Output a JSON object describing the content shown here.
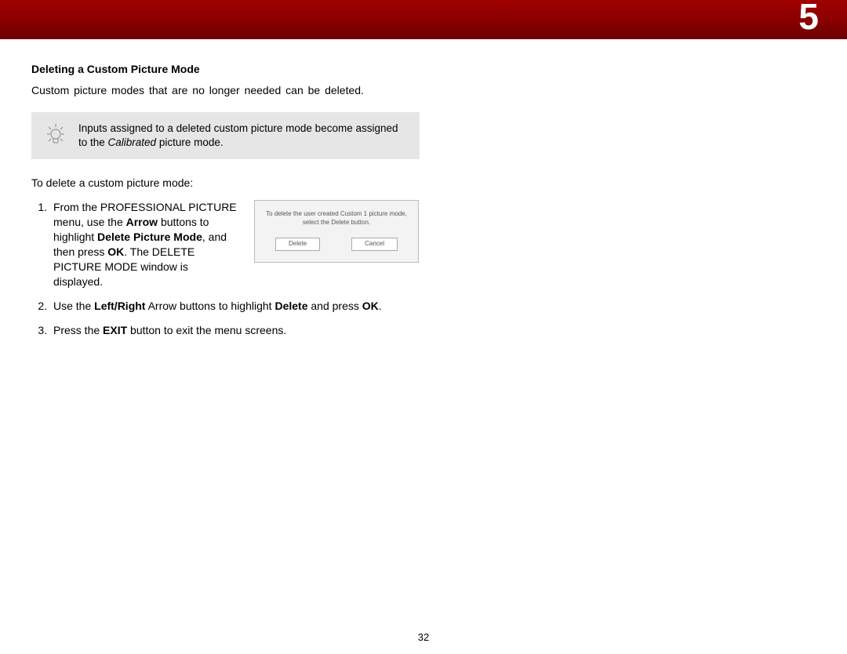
{
  "chapter": "5",
  "page_number": "32",
  "section_title": "Deleting a Custom Picture Mode",
  "intro": "Custom picture modes that are no longer needed can be deleted.",
  "tip_part1": "Inputs assigned to a deleted custom picture mode become assigned to the ",
  "tip_italic": "Calibrated",
  "tip_part2": " picture mode.",
  "lead": "To delete a custom picture mode:",
  "step1": {
    "t1": "From the PROFESSIONAL PICTURE menu, use the ",
    "b1": "Arrow",
    "t2": " buttons to highlight ",
    "b2": "Delete Picture Mode",
    "t3": ", and then press ",
    "b3": "OK",
    "t4": ". The DELETE PICTURE MODE window is displayed."
  },
  "dialog": {
    "line1": "To delete the user created Custom 1 picture mode,",
    "line2": "select the Delete button.",
    "btn_delete": "Delete",
    "btn_cancel": "Cancel"
  },
  "step2": {
    "t1": "Use the ",
    "b1": "Left/Right",
    "t2": " Arrow buttons to highlight ",
    "b2": "Delete",
    "t3": " and press ",
    "b3": "OK",
    "t4": "."
  },
  "step3": {
    "t1": "Press the ",
    "b1": "EXIT",
    "t2": " button to exit the menu screens."
  }
}
